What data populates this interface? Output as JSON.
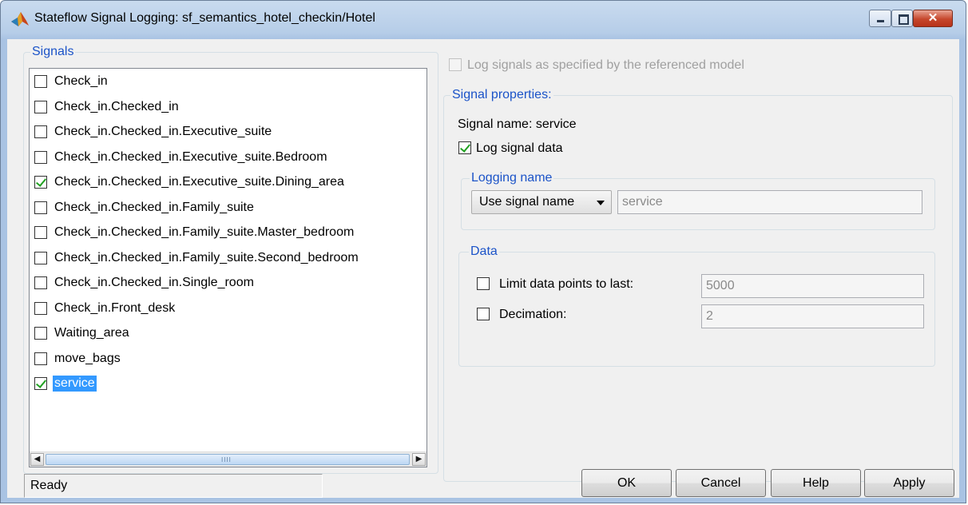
{
  "window": {
    "title": "Stateflow Signal Logging: sf_semantics_hotel_checkin/Hotel",
    "close_glyph": "✕"
  },
  "signals": {
    "legend": "Signals",
    "items": [
      {
        "label": "Check_in",
        "checked": false
      },
      {
        "label": "Check_in.Checked_in",
        "checked": false
      },
      {
        "label": "Check_in.Checked_in.Executive_suite",
        "checked": false
      },
      {
        "label": "Check_in.Checked_in.Executive_suite.Bedroom",
        "checked": false
      },
      {
        "label": "Check_in.Checked_in.Executive_suite.Dining_area",
        "checked": true
      },
      {
        "label": "Check_in.Checked_in.Family_suite",
        "checked": false
      },
      {
        "label": "Check_in.Checked_in.Family_suite.Master_bedroom",
        "checked": false
      },
      {
        "label": "Check_in.Checked_in.Family_suite.Second_bedroom",
        "checked": false
      },
      {
        "label": "Check_in.Checked_in.Single_room",
        "checked": false
      },
      {
        "label": "Check_in.Front_desk",
        "checked": false
      },
      {
        "label": "Waiting_area",
        "checked": false
      },
      {
        "label": "move_bags",
        "checked": false
      },
      {
        "label": "service",
        "checked": true,
        "selected": true
      }
    ],
    "scroll_left": "◀",
    "scroll_right": "▶",
    "grip": "IIII"
  },
  "reference": {
    "label": "Log signals as specified by the referenced model",
    "checked": false,
    "enabled": false
  },
  "properties": {
    "legend": "Signal properties:",
    "signal_name": "Signal name: service",
    "log_signal_data": {
      "label": "Log signal data",
      "checked": true
    },
    "logging_name": {
      "legend": "Logging name",
      "mode": "Use signal name",
      "value": "service"
    },
    "data": {
      "legend": "Data",
      "limit": {
        "label": "Limit data points to last:",
        "checked": false,
        "value": "5000"
      },
      "decimation": {
        "label": "Decimation:",
        "checked": false,
        "value": "2"
      }
    }
  },
  "status": "Ready",
  "buttons": {
    "ok": "OK",
    "cancel": "Cancel",
    "help": "Help",
    "apply": "Apply"
  },
  "colors": {
    "accent": "#1b53c8",
    "selection": "#3399ff",
    "check": "#21a121"
  }
}
